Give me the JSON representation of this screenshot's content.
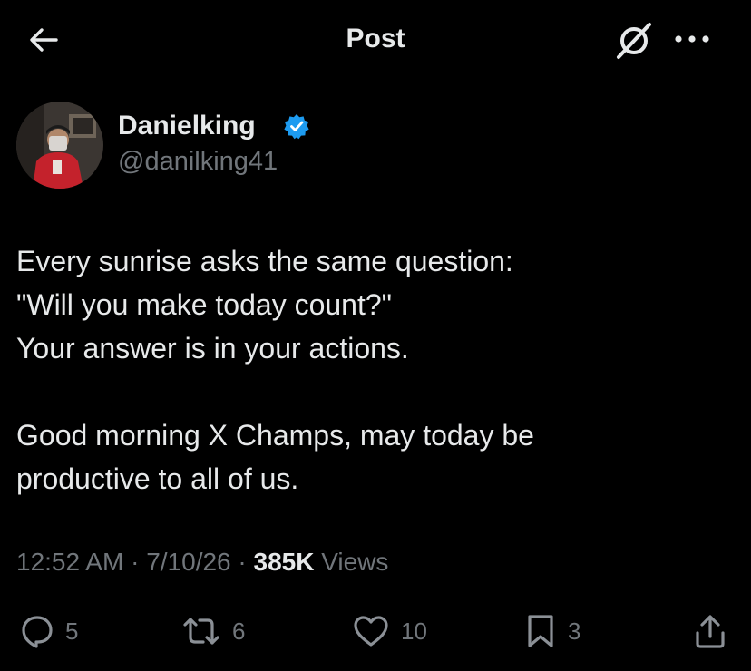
{
  "header": {
    "title": "Post",
    "back_icon": "arrow-left-icon",
    "grok_icon": "grok-icon",
    "more_icon": "more-dots-icon"
  },
  "author": {
    "display_name": "Danielking",
    "handle": "@danilking41",
    "verified": true,
    "verified_color": "#1d9bf0"
  },
  "post": {
    "lines": [
      "Every sunrise asks the same question:",
      "\"Will you make today count?\"",
      "Your answer is in your actions.",
      "",
      "Good morning X Champs, may today be",
      "productive to all of us."
    ]
  },
  "meta": {
    "time": "12:52 AM",
    "separator": "·",
    "date": "7/10/26",
    "views_count": "385K",
    "views_label": "Views"
  },
  "actions": {
    "replies": "5",
    "reposts": "6",
    "likes": "10",
    "bookmarks": "3"
  },
  "colors": {
    "background": "#000000",
    "primary_text": "#e7e9ea",
    "secondary_text": "#71767b",
    "accent": "#1d9bf0"
  }
}
